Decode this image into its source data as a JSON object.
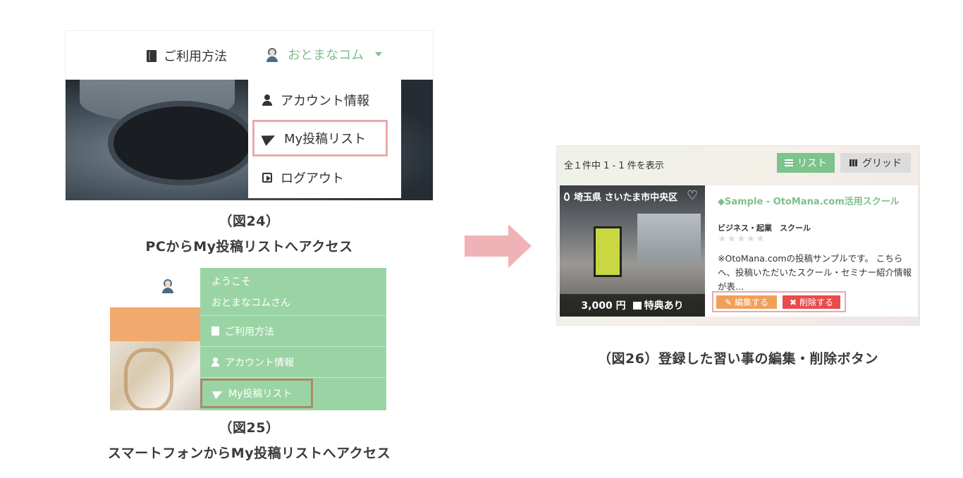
{
  "fig24": {
    "howto_label": "ご利用方法",
    "user_name": "おとまなコム",
    "menu": {
      "account": "アカウント情報",
      "my_posts": "My投稿リスト",
      "logout": "ログアウト"
    },
    "caption_num": "（図24）",
    "caption_text": "PCからMy投稿リストへアクセス"
  },
  "fig25": {
    "welcome": "ようこそ",
    "welcome_user": "おとまなコムさん",
    "menu": {
      "howto": "ご利用方法",
      "account": "アカウント情報",
      "my_posts": "My投稿リスト"
    },
    "caption_num": "（図25）",
    "caption_text": "スマートフォンからMy投稿リストへアクセス"
  },
  "fig26": {
    "count": "全１件中 1 - 1 件を表示",
    "list_button": "リスト",
    "grid_button": "グリッド",
    "location": "埼玉県 さいたま市中央区",
    "price": "3,000 円",
    "perk": "特典あり",
    "title": "◆Sample - OtoMana.com活用スクール",
    "categories": "ビジネス・起業　スクール",
    "stars": "★★★★★",
    "description": "※OtoMana.comの投稿サンプルです。 こちらへ、投稿いただいたスクール・セミナー紹介情報が表...",
    "edit_button": "編集する",
    "delete_button": "削除する",
    "caption": "（図26）登録した習い事の編集・削除ボタン"
  },
  "colors": {
    "green": "#7cc08a",
    "highlight_pink": "#e8a9ae",
    "arrow": "#f0b3b5",
    "edit": "#f0a05a",
    "delete": "#e74c4c"
  }
}
